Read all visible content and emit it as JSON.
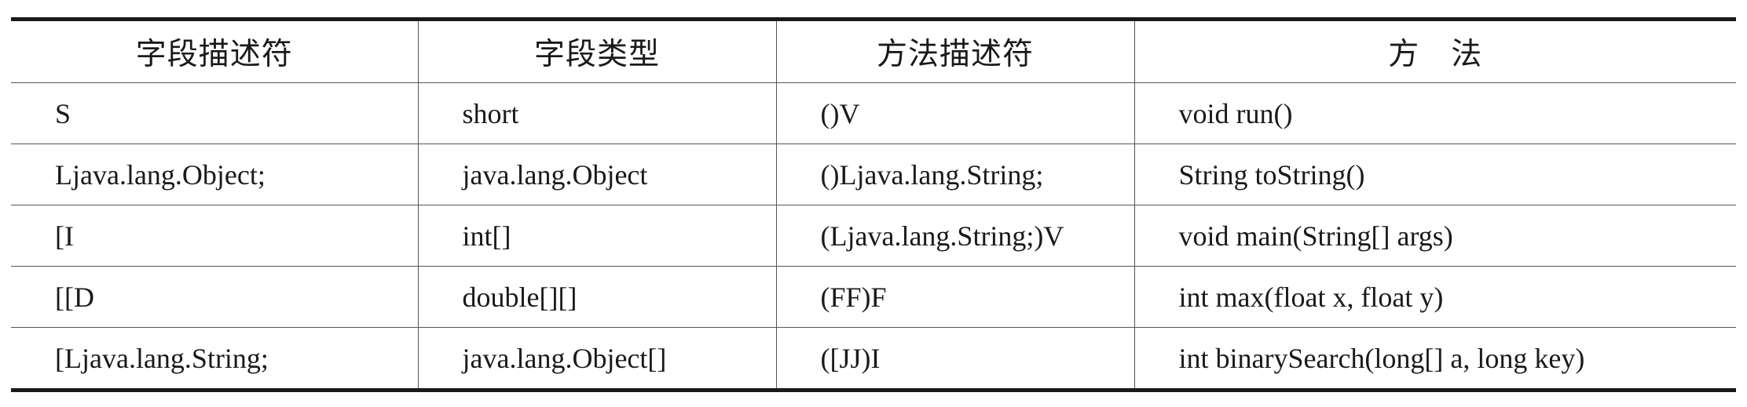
{
  "table": {
    "headers": [
      "字段描述符",
      "字段类型",
      "方法描述符",
      "方　法"
    ],
    "rows": [
      [
        "S",
        "short",
        "()V",
        "void run()"
      ],
      [
        "Ljava.lang.Object;",
        "java.lang.Object",
        "()Ljava.lang.String;",
        "String toString()"
      ],
      [
        "[I",
        "int[]",
        "(Ljava.lang.String;)V",
        "void main(String[] args)"
      ],
      [
        "[[D",
        "double[][]",
        "(FF)F",
        "int max(float x, float y)"
      ],
      [
        "[Ljava.lang.String;",
        "java.lang.Object[]",
        "([JJ)I",
        "int binarySearch(long[] a, long key)"
      ]
    ]
  }
}
